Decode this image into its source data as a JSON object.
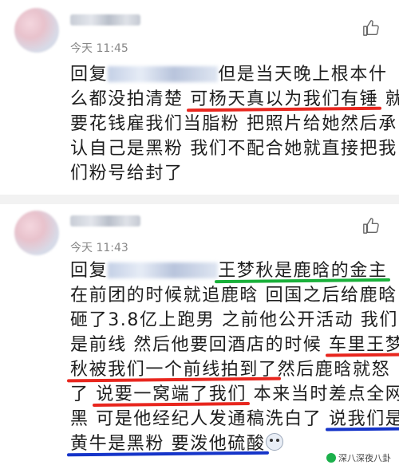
{
  "comments": [
    {
      "username": "",
      "time": "今天 11:45",
      "lines": {
        "l1_reply": "回复",
        "l1_blurred": "",
        "l1_rest": "但是当天晚上根本什",
        "l2_a": "么都没拍清楚 ",
        "l2_ul": "可杨天真以为我们有锤",
        "l2_b": " 就",
        "l3": "要花钱雇我们当脂粉 把照片给她然后承",
        "l4": "认自己是黑粉 我们不配合她就直接把我",
        "l5": "们粉号给封了"
      }
    },
    {
      "username": "",
      "time": "今天 11:43",
      "lines": {
        "l1_reply": "回复",
        "l1_blurred": "",
        "l1_ul": "王梦秋是鹿晗的金主",
        "l2": "在前团的时候就追鹿晗 回国之后给鹿晗",
        "l3": "砸了3.8亿上跑男 之前他公开活动 我们",
        "l4_a": "是前线 然后他要回酒店的时候 ",
        "l4_ul": "车里王梦",
        "l5_ul": "秋被我们一个前线拍到了",
        "l5_b": "然后鹿晗就怒",
        "l6_a": "了 ",
        "l6_ul": "说要一窝端了我们",
        "l6_b": " 本来当时差点全网",
        "l7_a": "黑 可是他经纪人发通稿洗白了 ",
        "l7_ul": "说我们是",
        "l8_ul": "黄牛是黑粉 要泼他硫酸"
      }
    }
  ],
  "watermark": "深八深夜八卦",
  "icons": {
    "like": "thumbs-up-icon",
    "emoji": "crying-face-icon",
    "watermark": "wechat-icon"
  },
  "colors": {
    "underline_red": "#e8261e",
    "underline_green": "#19b03a",
    "underline_blue": "#1534c9"
  }
}
